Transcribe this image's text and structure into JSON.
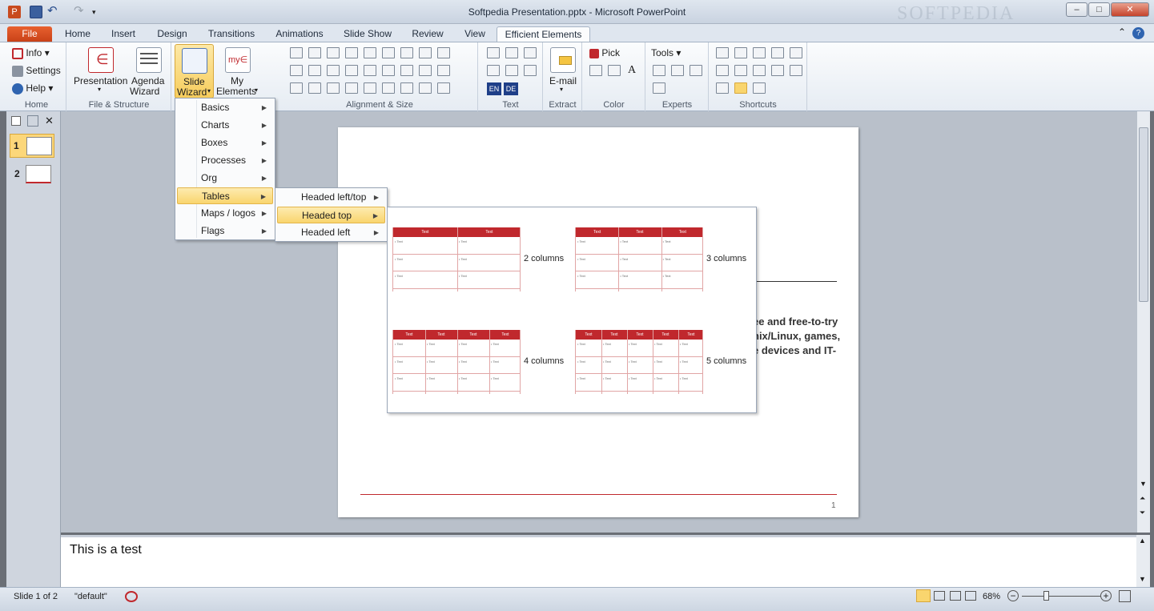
{
  "window": {
    "title": "Softpedia Presentation.pptx - Microsoft PowerPoint",
    "watermark": "SOFTPEDIA",
    "controls": {
      "minimize": "–",
      "maximize": "□",
      "close": "✕"
    }
  },
  "tabs": [
    "File",
    "Home",
    "Insert",
    "Design",
    "Transitions",
    "Animations",
    "Slide Show",
    "Review",
    "View",
    "Efficient Elements"
  ],
  "ribbon": {
    "home": {
      "items": [
        "Info",
        "Settings",
        "Help"
      ],
      "label": "Home"
    },
    "file_structure": {
      "presentation": "Presentation",
      "agenda1": "Agenda",
      "agenda2": "Wizard",
      "label": "File & Structure"
    },
    "wizard": {
      "slide1": "Slide",
      "slide2": "Wizard",
      "my1": "My",
      "my2": "Elements"
    },
    "alignment": {
      "label": "Alignment & Size"
    },
    "text": {
      "en": "EN",
      "de": "DE",
      "label": "Text"
    },
    "extract": {
      "email": "E-mail",
      "label": "Extract"
    },
    "color": {
      "pick": "Pick",
      "label": "Color"
    },
    "experts": {
      "tools": "Tools",
      "label": "Experts"
    },
    "shortcuts": {
      "label": "Shortcuts"
    }
  },
  "slide_wizard_menu": [
    "Basics",
    "Charts",
    "Boxes",
    "Processes",
    "Org",
    "Tables",
    "Maps / logos",
    "Flags"
  ],
  "tables_submenu": [
    "Headed left/top",
    "Headed top",
    "Headed left"
  ],
  "gallery": {
    "items": [
      {
        "label": "2 columns",
        "cols": 2
      },
      {
        "label": "3 columns",
        "cols": 3
      },
      {
        "label": "4 columns",
        "cols": 4
      },
      {
        "label": "5 columns",
        "cols": 5
      }
    ],
    "header_text": "Text",
    "cell_text": "• Text"
  },
  "slide": {
    "body_lines": [
      "ee and free-to-try",
      "nix/Linux, games,",
      "e devices and IT-"
    ],
    "page_number": "1"
  },
  "thumbnails": [
    "1",
    "2"
  ],
  "notes": "This is a test",
  "status": {
    "slide": "Slide 1 of 2",
    "theme": "\"default\"",
    "zoom": "68%"
  },
  "colors": {
    "accent_red": "#c0282d",
    "file_tab": "#d24b1f",
    "highlight": "#f9d56e"
  }
}
